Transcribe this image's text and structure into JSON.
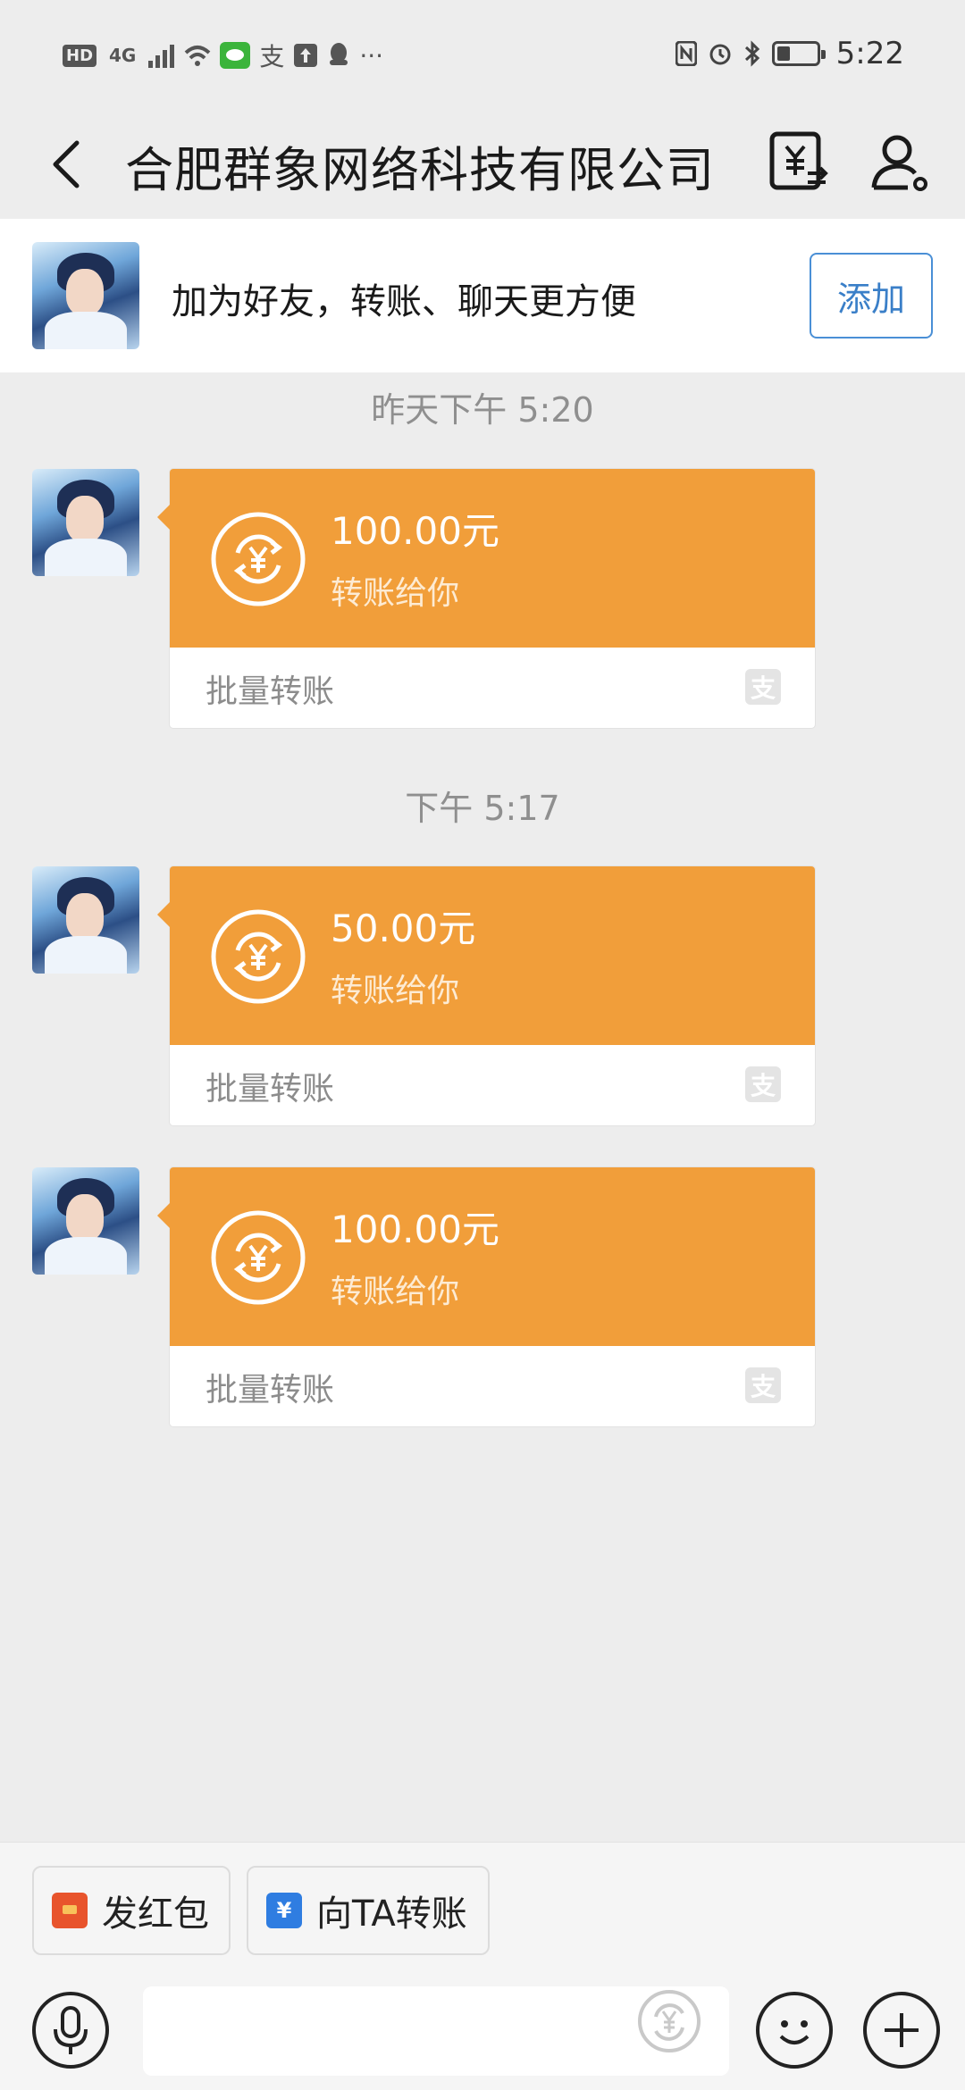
{
  "status_bar": {
    "left_badges": [
      "HD",
      "4G"
    ],
    "time": "5:22",
    "colors": {
      "wechat": "#3bb43b"
    }
  },
  "header": {
    "title": "合肥群象网络科技有限公司",
    "back_icon": "back-chevron-icon",
    "transfer_icon": "yuan-transfer-icon",
    "profile_icon": "user-profile-icon"
  },
  "banner": {
    "text": "加为好友，转账、聊天更方便",
    "add_label": "添加",
    "accent": "#4a8fd6"
  },
  "chat": {
    "groups": [
      {
        "time": "昨天下午 5:20",
        "messages": [
          {
            "amount": "100.00元",
            "subtitle": "转账给你",
            "footer": "批量转账"
          }
        ]
      },
      {
        "time": "下午 5:17",
        "messages": [
          {
            "amount": "50.00元",
            "subtitle": "转账给你",
            "footer": "批量转账"
          },
          {
            "amount": "100.00元",
            "subtitle": "转账给你",
            "footer": "批量转账"
          }
        ]
      }
    ],
    "card_color": "#f19e3a",
    "alipay_glyph": "支"
  },
  "quick_actions": [
    {
      "label": "发红包",
      "icon": "red-packet-icon"
    },
    {
      "label": "向TA转账",
      "icon": "transfer-icon",
      "icon_glyph": "¥"
    }
  ],
  "input_bar": {
    "placeholder": ""
  }
}
